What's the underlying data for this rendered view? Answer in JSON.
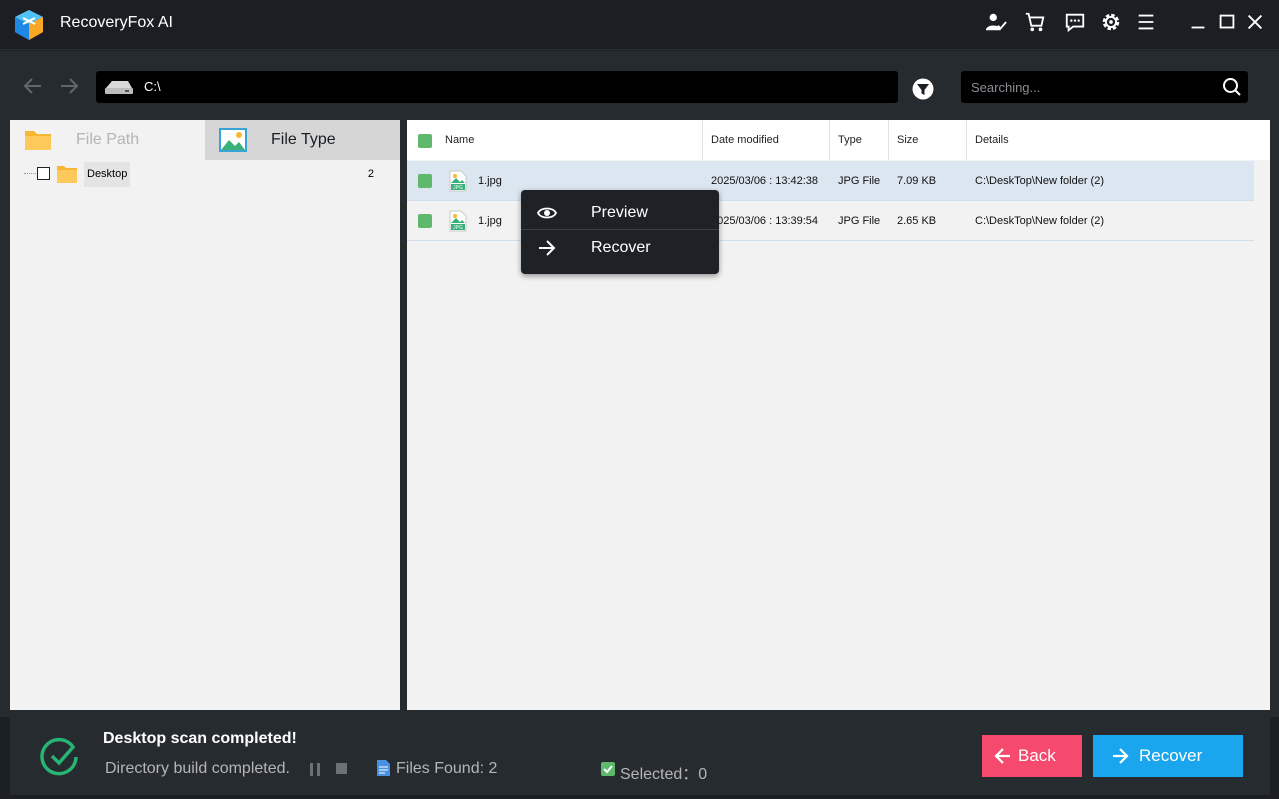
{
  "app": {
    "title": "RecoveryFox AI"
  },
  "titlebar_icons": [
    "user-check-icon",
    "cart-icon",
    "chat-icon",
    "gear-icon",
    "menu-icon",
    "minimize-icon",
    "maximize-icon",
    "close-icon"
  ],
  "nav": {
    "path": "C:\\",
    "search_placeholder": "Searching..."
  },
  "left_panel": {
    "tabs": [
      {
        "label": "File Path",
        "active": false
      },
      {
        "label": "File Type",
        "active": true
      }
    ],
    "tree": [
      {
        "label": "Desktop",
        "count": "2",
        "checked": false
      }
    ]
  },
  "table": {
    "headers": {
      "name": "Name",
      "date": "Date modified",
      "type": "Type",
      "size": "Size",
      "details": "Details"
    },
    "rows": [
      {
        "name": "1.jpg",
        "date": "2025/03/06 : 13:42:38",
        "type": "JPG File",
        "size": "7.09 KB",
        "details": "C:\\DeskTop\\New folder (2)",
        "selected": true
      },
      {
        "name": "1.jpg",
        "date": "2025/03/06 : 13:39:54",
        "type": "JPG File",
        "size": "2.65 KB",
        "details": "C:\\DeskTop\\New folder (2)",
        "selected": false
      }
    ]
  },
  "context_menu": {
    "items": [
      {
        "label": "Preview",
        "icon": "eye-icon"
      },
      {
        "label": "Recover",
        "icon": "arrow-right-icon"
      }
    ]
  },
  "status": {
    "title": "Desktop scan completed!",
    "subtitle": "Directory build completed.",
    "files_found": "Files Found: 2",
    "selected": "Selected：0"
  },
  "buttons": {
    "back": "Back",
    "recover": "Recover"
  },
  "colors": {
    "accent_blue": "#1aa6ee",
    "back_pink": "#f54a6e",
    "check_green": "#5fb96d",
    "status_green": "#27b574"
  }
}
